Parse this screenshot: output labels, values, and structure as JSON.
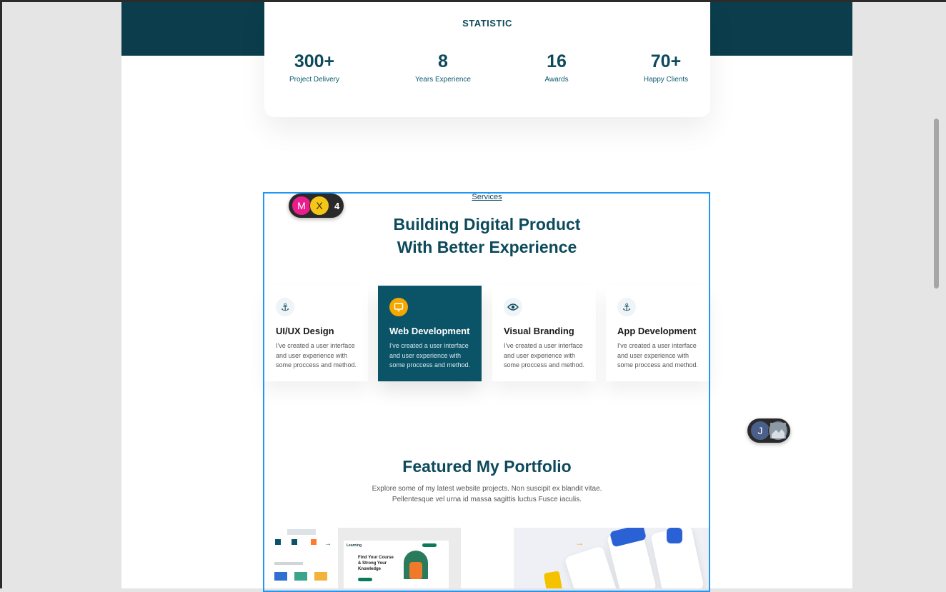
{
  "stats": {
    "title": "STATISTIC",
    "items": [
      {
        "value": "300+",
        "label": "Project Delivery"
      },
      {
        "value": "8",
        "label": "Years Experience"
      },
      {
        "value": "16",
        "label": "Awards"
      },
      {
        "value": "70+",
        "label": "Happy Clients"
      }
    ]
  },
  "services": {
    "eyebrow": "Services",
    "heading_line1": "Building Digital Product",
    "heading_line2": "With Better Experience",
    "items": [
      {
        "title": "UI/UX Design",
        "desc": "I've created a user interface and user experience with some proccess and method.",
        "icon": "anchor-icon"
      },
      {
        "title": "Web Development",
        "desc": "I've created a user interface and user experience with some proccess and method.",
        "icon": "monitor-icon"
      },
      {
        "title": "Visual Branding",
        "desc": "I've created a user interface and user experience with some proccess and method.",
        "icon": "eye-icon"
      },
      {
        "title": "App Development",
        "desc": "I've created a user interface and user experience with some proccess and method.",
        "icon": "anchor-icon"
      }
    ]
  },
  "portfolio": {
    "heading": "Featured My Portfolio",
    "subtitle": "Explore some of my latest website projects. Non suscipit ex blandit vitae. Pellentesque vel urna id massa sagittis luctus Fusce iaculis.",
    "thumb1": {
      "logo": "Learning",
      "headline": "Find Your Course & Strong Your Knowledge"
    }
  },
  "collaborators": {
    "group1": {
      "avatars": [
        "M",
        "X"
      ],
      "extra_count": "4"
    },
    "group2": {
      "avatars": [
        "J"
      ]
    }
  },
  "colors": {
    "primary": "#0b3d4c",
    "accent": "#f5a700",
    "selection": "#2196f3"
  }
}
